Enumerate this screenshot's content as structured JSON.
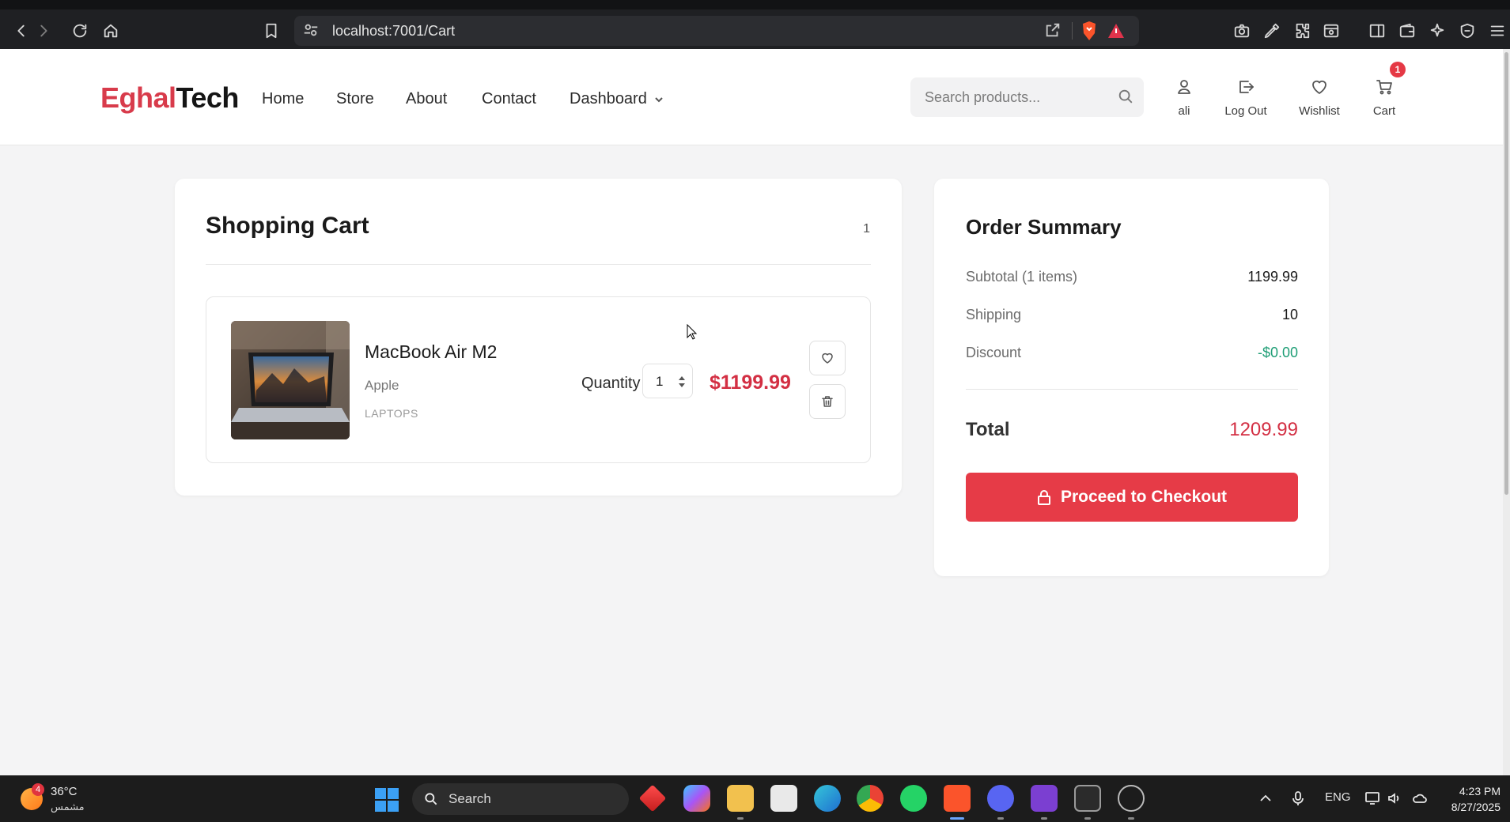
{
  "browser": {
    "url": "localhost:7001/Cart"
  },
  "header": {
    "logo_part1": "Eghal",
    "logo_part2": "Tech",
    "nav": {
      "home": "Home",
      "store": "Store",
      "about": "About",
      "contact": "Contact",
      "dashboard": "Dashboard"
    },
    "search_placeholder": "Search products...",
    "user_label": "ali",
    "logout_label": "Log Out",
    "wishlist_label": "Wishlist",
    "cart_label": "Cart",
    "cart_badge": "1"
  },
  "cart": {
    "title": "Shopping Cart",
    "count": "1",
    "items": [
      {
        "name": "MacBook Air M2",
        "brand": "Apple",
        "category": "LAPTOPS",
        "quantity_label": "Quantity",
        "quantity": "1",
        "price": "$1199.99"
      }
    ]
  },
  "summary": {
    "title": "Order Summary",
    "subtotal_label": "Subtotal (1 items)",
    "subtotal_value": "1199.99",
    "shipping_label": "Shipping",
    "shipping_value": "10",
    "discount_label": "Discount",
    "discount_value": "-$0.00",
    "total_label": "Total",
    "total_value": "1209.99",
    "checkout_label": "Proceed to Checkout"
  },
  "taskbar": {
    "weather_temp": "36°C",
    "weather_condition": "مشمس",
    "weather_badge": "4",
    "search_label": "Search",
    "language": "ENG",
    "time": "4:23 PM",
    "date": "8/27/2025"
  },
  "colors": {
    "brand_red": "#d83b4b",
    "price_red": "#d32f43",
    "checkout_red": "#e63b47",
    "discount_green": "#1f9e76"
  }
}
